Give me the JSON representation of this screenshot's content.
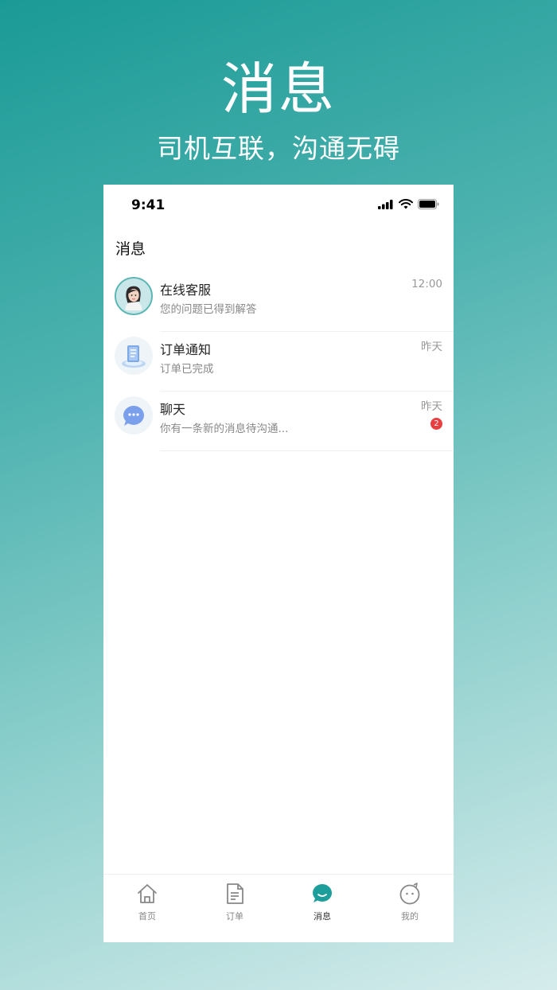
{
  "hero": {
    "title": "消息",
    "subtitle": "司机互联，沟通无碍"
  },
  "status_bar": {
    "time": "9:41"
  },
  "page": {
    "title": "消息"
  },
  "messages": [
    {
      "name": "在线客服",
      "preview": "您的问题已得到解答",
      "time": "12:00",
      "avatar": "agent-avatar"
    },
    {
      "name": "订单通知",
      "preview": "订单已完成",
      "time": "昨天",
      "avatar": "order-notice-icon"
    },
    {
      "name": "聊天",
      "preview": "你有一条新的消息待沟通...",
      "time": "昨天",
      "badge": "2",
      "avatar": "chat-bubble-icon"
    }
  ],
  "tabbar": [
    {
      "label": "首页",
      "icon": "home-icon",
      "active": false
    },
    {
      "label": "订单",
      "icon": "order-icon",
      "active": false
    },
    {
      "label": "消息",
      "icon": "message-icon",
      "active": true
    },
    {
      "label": "我的",
      "icon": "profile-icon",
      "active": false
    }
  ],
  "colors": {
    "accent": "#1e9e9a",
    "badge": "#e84040"
  }
}
